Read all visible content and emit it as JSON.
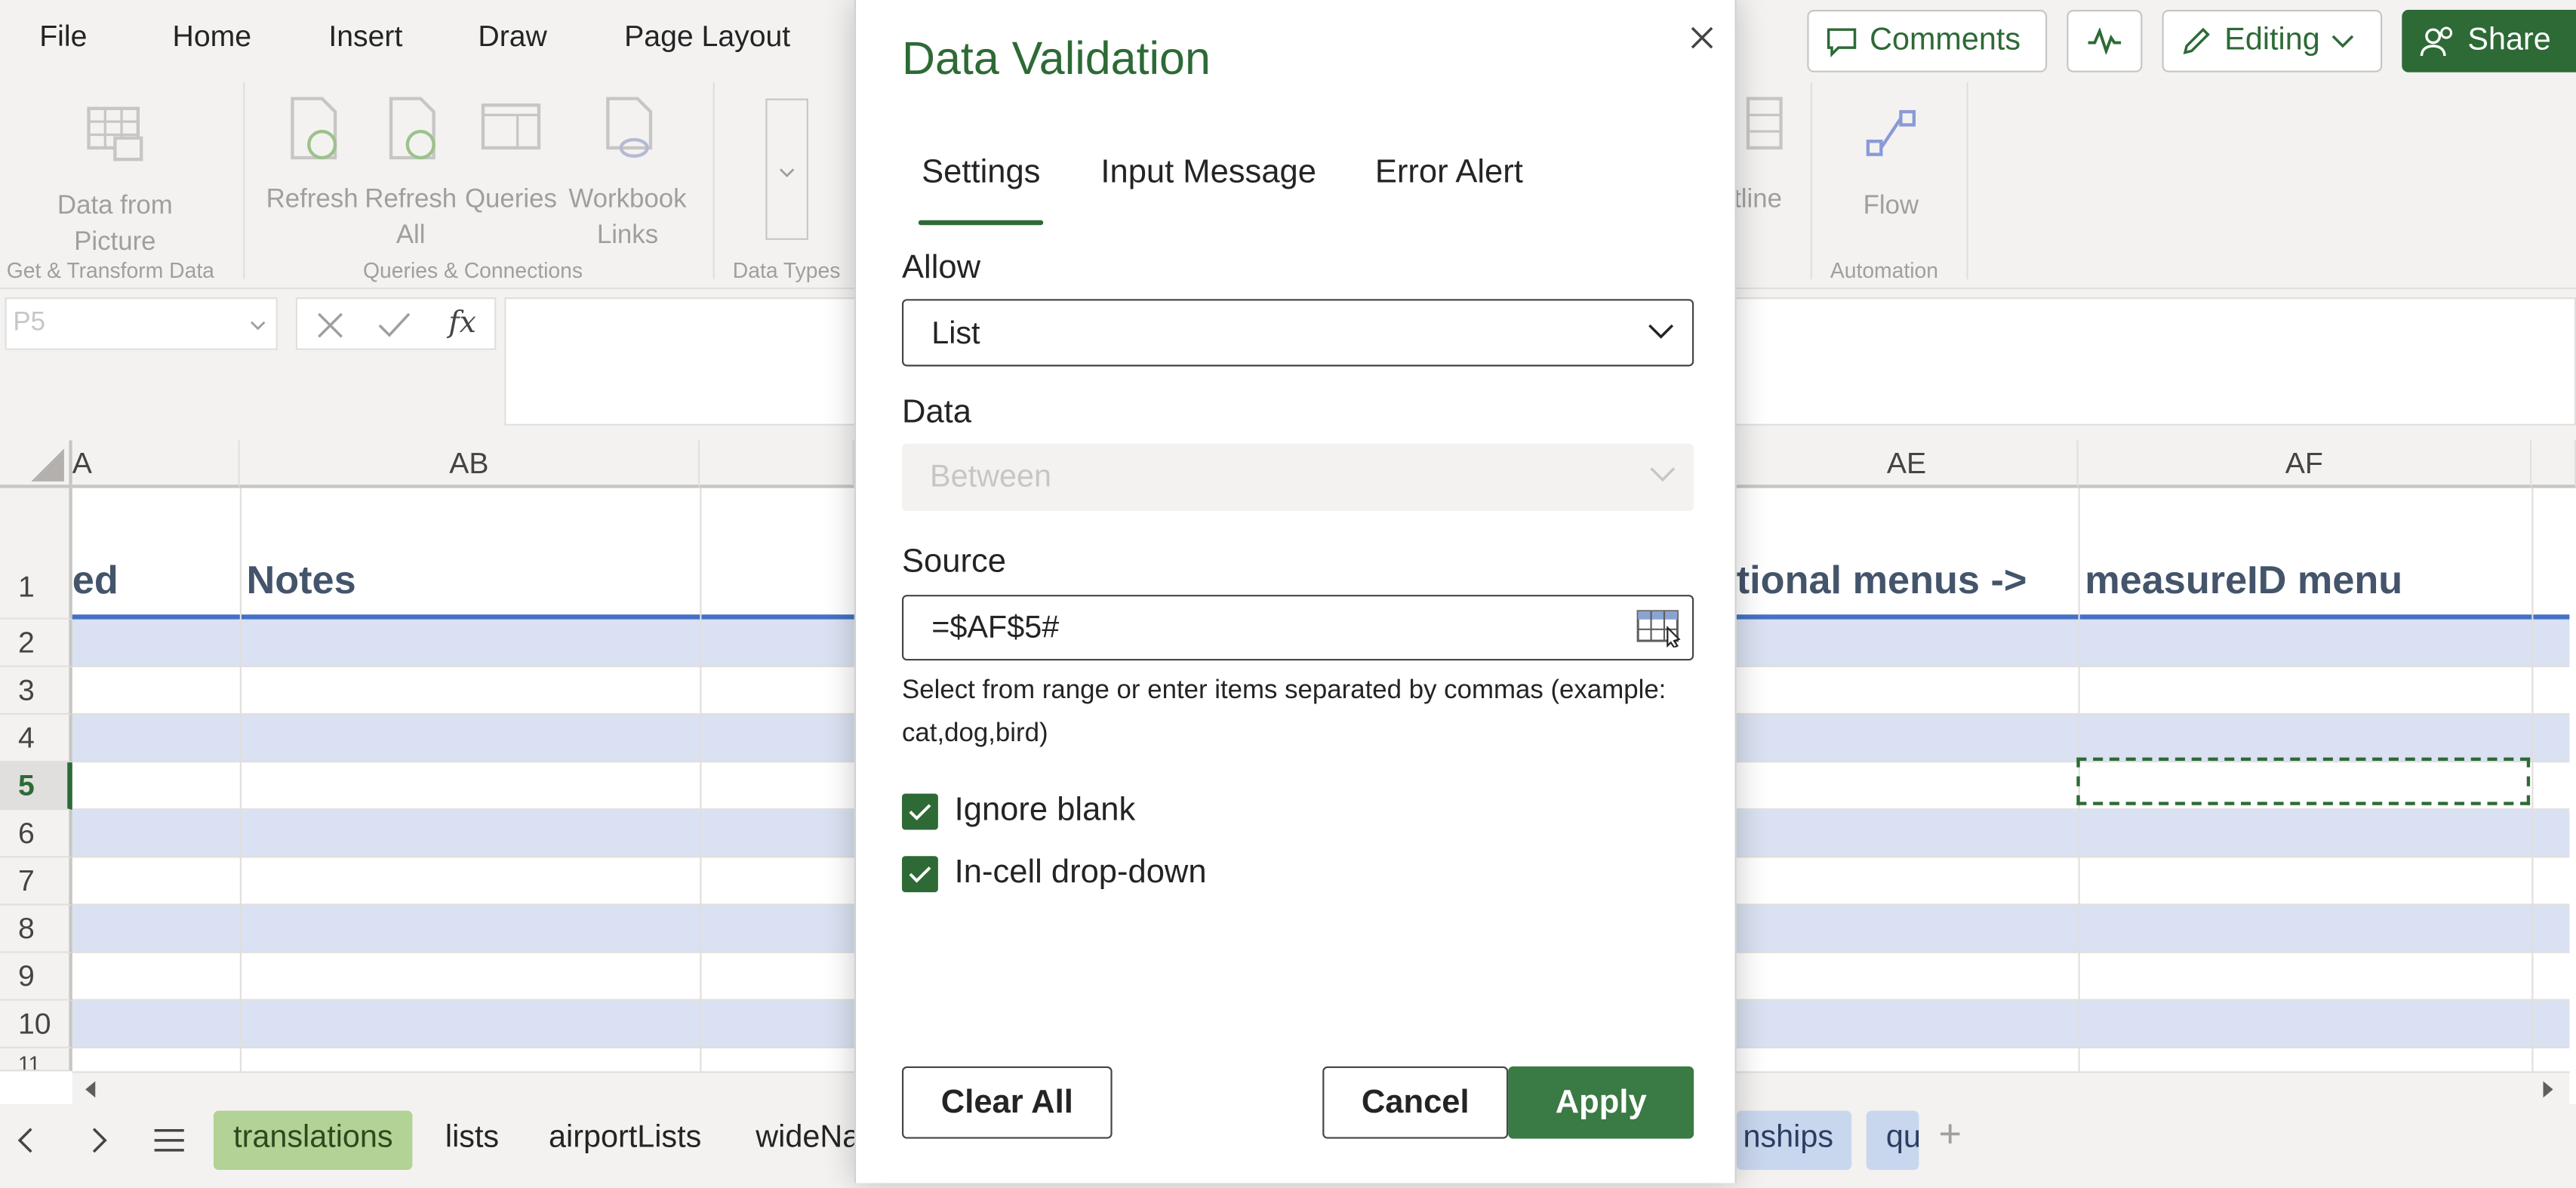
{
  "menubar": {
    "items": [
      "File",
      "Home",
      "Insert",
      "Draw",
      "Page Layout"
    ],
    "comments_label": "Comments",
    "editing_label": "Editing",
    "share_label": "Share"
  },
  "ribbon": {
    "data_from_picture": "Data from Picture",
    "refresh": "Refresh",
    "refresh_all": "Refresh All",
    "queries": "Queries",
    "workbook_links": "Workbook Links",
    "outline": "tline",
    "flow": "Flow",
    "groups": {
      "get_transform": "Get & Transform Data",
      "queries_connections": "Queries & Connections",
      "data_types": "Data Types",
      "automation": "Automation"
    }
  },
  "formula_bar": {
    "name_box": "P5",
    "fx_label": "fx"
  },
  "grid": {
    "columns": [
      "A",
      "AB",
      "AE",
      "AF"
    ],
    "rows": [
      "1",
      "2",
      "3",
      "4",
      "5",
      "6",
      "7",
      "8",
      "9",
      "10",
      "11"
    ],
    "header_cells": {
      "col_a": "ed",
      "col_ab": "Notes",
      "col_ae": "tional menus ->",
      "col_af": "measureID menu"
    }
  },
  "sheet_tabs": {
    "tabs": [
      "translations",
      "lists",
      "airportLists",
      "wideNa"
    ],
    "right_tabs": [
      "nships",
      "qu"
    ],
    "add_label": "+"
  },
  "dialog": {
    "title": "Data Validation",
    "tabs": [
      "Settings",
      "Input Message",
      "Error Alert"
    ],
    "allow_label": "Allow",
    "allow_value": "List",
    "data_label": "Data",
    "data_value": "Between",
    "source_label": "Source",
    "source_value": "=$AF$5#",
    "help_text": "Select from range or enter items separated by commas (example: cat,dog,bird)",
    "ignore_blank_label": "Ignore blank",
    "ignore_blank_checked": true,
    "incell_dropdown_label": "In-cell drop-down",
    "incell_dropdown_checked": true,
    "clear_all_label": "Clear All",
    "cancel_label": "Cancel",
    "apply_label": "Apply"
  },
  "colors": {
    "accent_green": "#2d6a36",
    "header_text": "#44546a",
    "band_blue": "#d9e1f2",
    "header_underline": "#4472c4",
    "selection_dash": "#2d6a36"
  }
}
